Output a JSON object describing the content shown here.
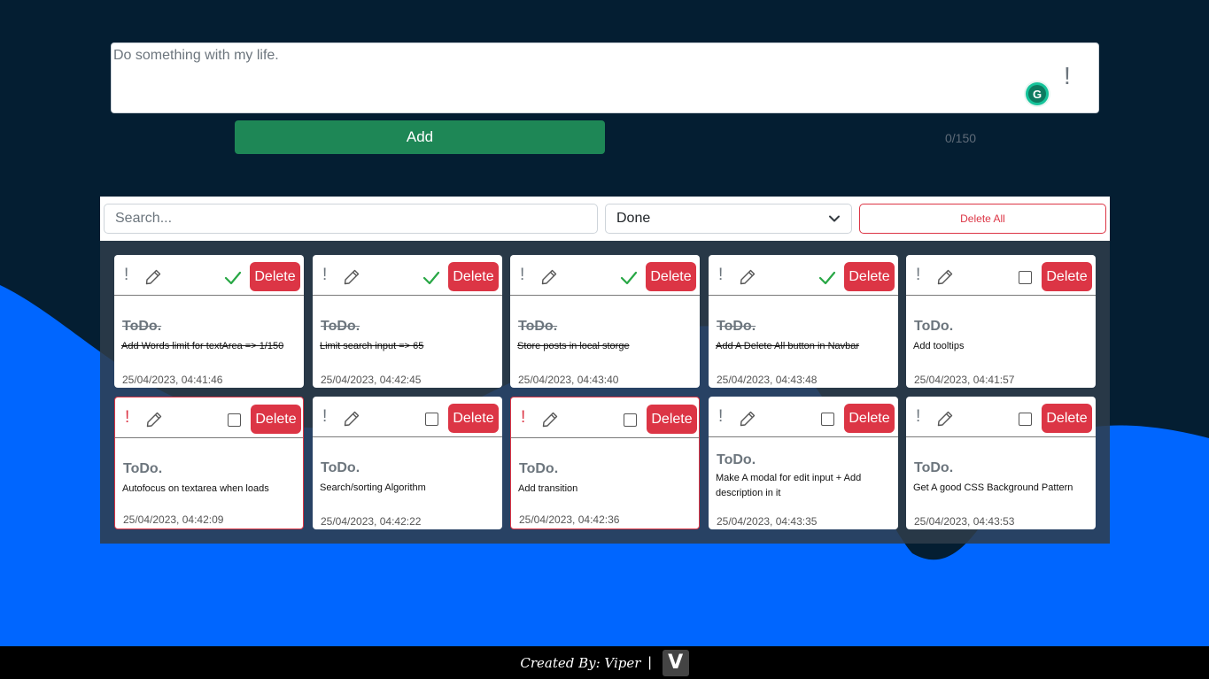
{
  "composer": {
    "textarea_value": "Do something with my life.",
    "priority_icon": "!",
    "add_label": "Add",
    "counter": "0/150",
    "grammarly_glyph": "G"
  },
  "toolbar": {
    "search_placeholder": "Search...",
    "filter_selected": "Done",
    "delete_all_label": "Delete All"
  },
  "cards": [
    {
      "title": "ToDo.",
      "text": "Add Words limit for textArea => 1/150",
      "date": "25/04/2023, 04:41:46",
      "done": true,
      "urgent": false,
      "priority": "!",
      "delete_label": "Delete"
    },
    {
      "title": "ToDo.",
      "text": "Limit search input => 65",
      "date": "25/04/2023, 04:42:45",
      "done": true,
      "urgent": false,
      "priority": "!",
      "delete_label": "Delete"
    },
    {
      "title": "ToDo.",
      "text": "Store posts in local storge",
      "date": "25/04/2023, 04:43:40",
      "done": true,
      "urgent": false,
      "priority": "!",
      "delete_label": "Delete"
    },
    {
      "title": "ToDo.",
      "text": "Add A Delete All button in Navbar",
      "date": "25/04/2023, 04:43:48",
      "done": true,
      "urgent": false,
      "priority": "!",
      "delete_label": "Delete"
    },
    {
      "title": "ToDo.",
      "text": "Add tooltips",
      "date": "25/04/2023, 04:41:57",
      "done": false,
      "urgent": false,
      "priority": "!",
      "delete_label": "Delete"
    },
    {
      "title": "ToDo.",
      "text": "Autofocus on textarea when loads",
      "date": "25/04/2023, 04:42:09",
      "done": false,
      "urgent": true,
      "priority": "!",
      "delete_label": "Delete"
    },
    {
      "title": "ToDo.",
      "text": "Search/sorting Algorithm",
      "date": "25/04/2023, 04:42:22",
      "done": false,
      "urgent": false,
      "priority": "!",
      "delete_label": "Delete"
    },
    {
      "title": "ToDo.",
      "text": "Add transition",
      "date": "25/04/2023, 04:42:36",
      "done": false,
      "urgent": true,
      "priority": "!",
      "delete_label": "Delete"
    },
    {
      "title": "ToDo.",
      "text": "Make A modal for edit input + Add description in it",
      "date": "25/04/2023, 04:43:35",
      "done": false,
      "urgent": false,
      "priority": "!",
      "delete_label": "Delete"
    },
    {
      "title": "ToDo.",
      "text": "Get A good CSS Background Pattern",
      "date": "25/04/2023, 04:43:53",
      "done": false,
      "urgent": false,
      "priority": "!",
      "delete_label": "Delete"
    }
  ],
  "footer": {
    "credit": "Created By: Viper",
    "separator": "|",
    "logo_letter": "V"
  },
  "colors": {
    "page_background": "#041e32",
    "wave_blue": "#0066ff",
    "add_green": "#1e8756",
    "delete_red": "#dc3545",
    "check_green": "#28a745"
  }
}
